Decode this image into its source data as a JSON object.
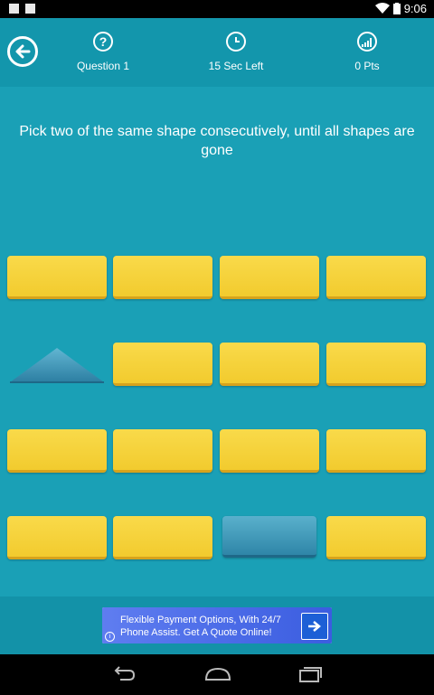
{
  "statusbar": {
    "time": "9:06"
  },
  "header": {
    "question_label": "Question 1",
    "time_label": "15 Sec Left",
    "points_label": "0 Pts",
    "question_icon_glyph": "?"
  },
  "instructions": "Pick two of the same shape consecutively, until all shapes are gone",
  "tiles": [
    [
      "hidden",
      "hidden",
      "hidden",
      "hidden"
    ],
    [
      "triangle",
      "hidden",
      "hidden",
      "hidden"
    ],
    [
      "hidden",
      "hidden",
      "hidden",
      "hidden"
    ],
    [
      "hidden",
      "hidden",
      "rectangle",
      "hidden"
    ]
  ],
  "colors": {
    "background": "#1aa0b6",
    "header": "#1396ac",
    "tile_hidden": "#f6d03a",
    "shape": "#3d95b8"
  },
  "ad": {
    "line1": "Flexible Payment Options, With 24/7",
    "line2": "Phone Assist. Get A Quote Online!"
  },
  "icons": {
    "back": "arrow-left-circle-icon",
    "question": "question-circle-icon",
    "clock": "clock-icon",
    "points": "signal-bars-icon"
  }
}
